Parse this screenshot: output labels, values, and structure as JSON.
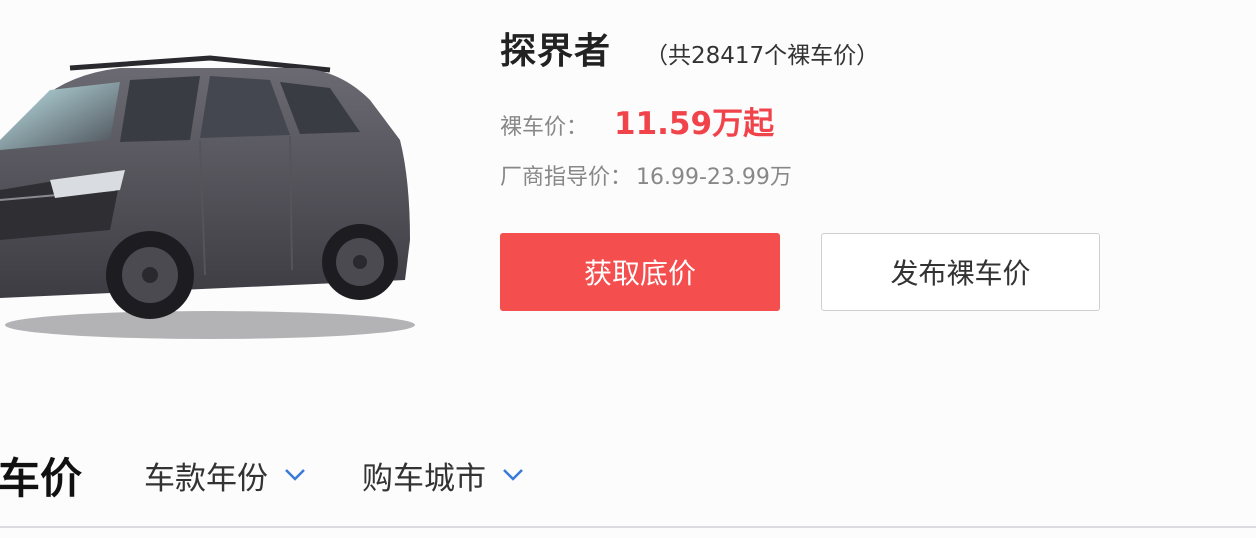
{
  "car": {
    "model_name": "探界者",
    "price_count": "（共28417个裸车价）",
    "price_label": "裸车价：",
    "price_value": "11.59万起",
    "guide_label": "厂商指导价：",
    "guide_value": "16.99-23.99万",
    "image_icon": "suv-car-image",
    "price_color": "#f0434a"
  },
  "buttons": {
    "get_lowest_price": "获取底价",
    "publish_price": "发布裸车价",
    "primary_color": "#f44e4e"
  },
  "filter_bar": {
    "section_title": "车价",
    "model_year_label": "车款年份",
    "city_label": "购车城市",
    "chevron_icon": "chevron-down-icon",
    "chevron_color": "#3a7bd5"
  }
}
